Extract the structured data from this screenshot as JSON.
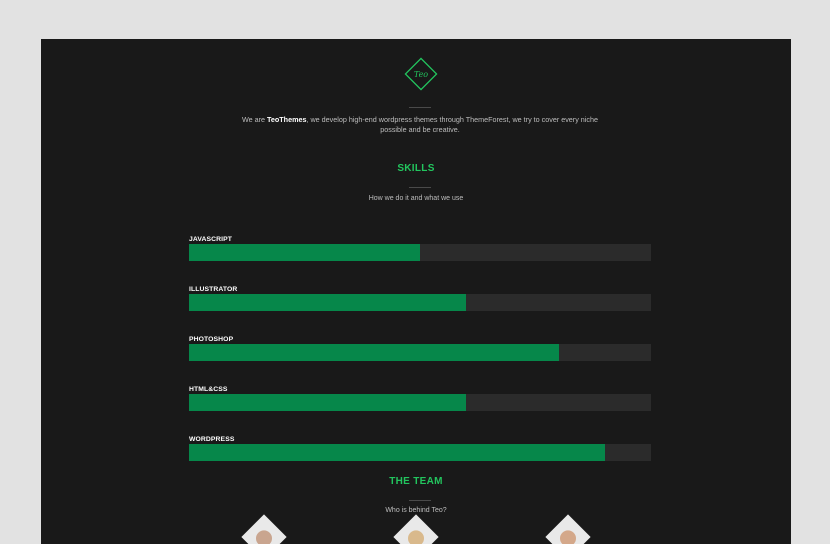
{
  "logo": {
    "text": "Teo",
    "color": "#22c55e"
  },
  "intro": {
    "prefix": "We are ",
    "brand": "TeoThemes",
    "suffix": ", we develop high-end wordpress themes through ThemeForest, we try to cover every niche possible and be creative."
  },
  "skills": {
    "title": "SKILLS",
    "subtitle": "How we do it and what we use",
    "items": [
      {
        "label": "JAVASCRIPT",
        "percent": 50
      },
      {
        "label": "ILLUSTRATOR",
        "percent": 60
      },
      {
        "label": "PHOTOSHOP",
        "percent": 80
      },
      {
        "label": "HTML&CSS",
        "percent": 60
      },
      {
        "label": "WORDPRESS",
        "percent": 90
      }
    ]
  },
  "team": {
    "title": "THE TEAM",
    "subtitle": "Who is behind Teo?"
  },
  "colors": {
    "accent": "#22c55e",
    "bar_fill": "#06874a",
    "bar_track": "#2b2b2b",
    "background": "#191919"
  }
}
